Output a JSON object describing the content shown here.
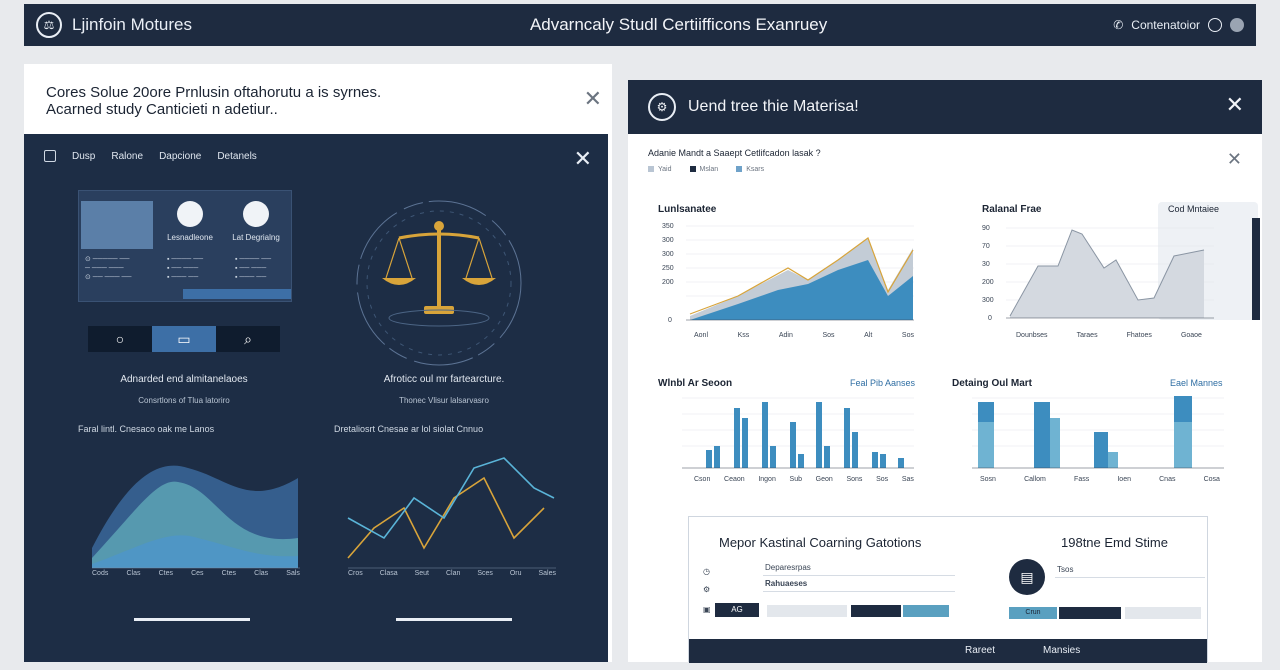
{
  "topbar": {
    "brand": "Ljinfoin Motures",
    "title": "Advarncaly Studl Certiifficons Exanruey",
    "right_label": "Contenatoior"
  },
  "left": {
    "header_line1": "Cores Solue 20ore Prnlusin oftahorutu a is syrnes.",
    "header_line2": "Acarned study Canticieti n adetiur..",
    "nav": [
      "Dusp",
      "Ralone",
      "Dapcione",
      "Detanels"
    ],
    "profiles": [
      "Lesnadleone",
      "Lat Degrialng"
    ],
    "caption_left": "Adnarded end almitanelaoes",
    "subcaption_left": "Consrtlons of  Tlua latoriro",
    "caption_right": "Afroticc oul mr fartearcture.",
    "subcaption_right": "Thonec Vlisur lalsarvasro",
    "chart1_title": "Faral lintl.  Cnesaco oak me Lanos",
    "chart2_title": "Dretaliosrt  Cnesae  ar lol siolat Cnnuo",
    "chart1_x": [
      "Cods",
      "Clas",
      "Ctes",
      "Ces",
      "Ctes",
      "Clas",
      "Sals"
    ],
    "chart2_x": [
      "Cros",
      "Clasa",
      "Seut",
      "Clan",
      "Sces",
      "Oru",
      "Sales"
    ]
  },
  "right": {
    "title": "Uend tree thie Materisa!",
    "subhead": "Adanie Mandt a  Saaept Cetlifcadon lasak ?",
    "legend": [
      "Yaid",
      "Mslan",
      "Ksars"
    ],
    "tab_note": "Cod Mntaiee",
    "charts": [
      {
        "title": "Lunlsanatee",
        "link": ""
      },
      {
        "title": "Ralanal Frae",
        "link": ""
      },
      {
        "title": "Wlnbl Ar Seoon",
        "link": "Feal Pib Aanses"
      },
      {
        "title": "Detaing Oul Mart",
        "link": "Eael Mannes"
      }
    ],
    "c1_x": [
      "Aonl",
      "Kss",
      "Adin",
      "Sos",
      "Alt",
      "Sos"
    ],
    "c1_y": [
      "350",
      "300",
      "300",
      "250",
      "200",
      "0"
    ],
    "c2_x": [
      "Dounbses",
      "Taraes",
      "Fhatoes",
      "Goaoe"
    ],
    "c2_y": [
      "90",
      "70",
      "30",
      "200",
      "300",
      "0"
    ],
    "c3_x": [
      "Cson",
      "Ceaon",
      "Ingon",
      "Sub",
      "Geon",
      "Sons",
      "Sos",
      "Sas"
    ],
    "c4_x": [
      "Sosn",
      "Callom",
      "Fass",
      "Ioen",
      "Cnas",
      "Cosa"
    ],
    "bottom_title_left": "Mepor Kastinal Coarning Gatotions",
    "bottom_title_right": "198tne Emd Stime",
    "bottom_label1": "Deparesrpas",
    "bottom_label2": "Rahuaeses",
    "bottom_label3": "Tsos",
    "bottom_btn_left": "AG",
    "bottom_btn_right": "Crun",
    "bottom_footer_left": "Rareet",
    "bottom_footer_right": "Mansies"
  },
  "colors": {
    "navy": "#1e2b40",
    "dark_panel": "#1d2d45",
    "accent_blue": "#3d6fa6",
    "chart_blue": "#3d8dbf",
    "gold": "#d8a43a"
  }
}
